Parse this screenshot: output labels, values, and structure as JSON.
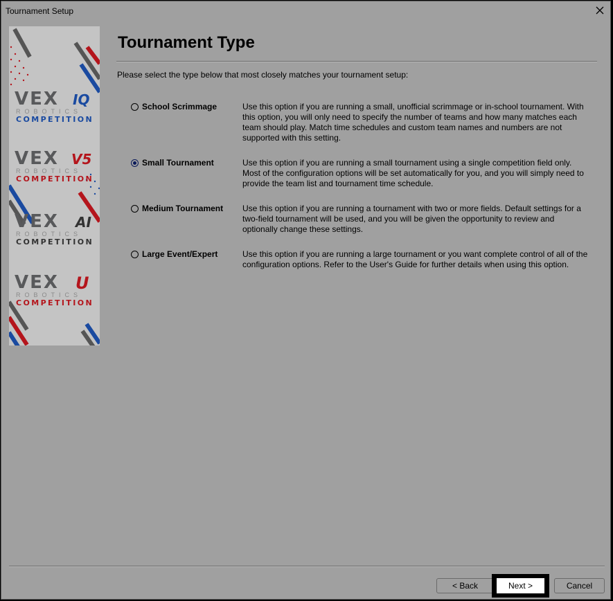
{
  "window": {
    "title": "Tournament Setup",
    "close_icon": "close-icon"
  },
  "banner": {
    "logos": [
      {
        "vex": "VEX",
        "suffix": "IQ",
        "robotics": "ROBOTICS",
        "competition": "COMPETITION",
        "accent": "#1a4aa0"
      },
      {
        "vex": "VEX",
        "suffix": "V5",
        "robotics": "ROBOTICS",
        "competition": "COMPETITION",
        "accent": "#b4151c"
      },
      {
        "vex": "VEX",
        "suffix": "AI",
        "robotics": "ROBOTICS",
        "competition": "COMPETITION",
        "accent": "#333333"
      },
      {
        "vex": "VEX",
        "suffix": "U",
        "robotics": "ROBOTICS",
        "competition": "COMPETITION",
        "accent": "#b4151c"
      }
    ]
  },
  "page": {
    "heading": "Tournament Type",
    "instruction": "Please select the type below that most closely matches your tournament setup:"
  },
  "options": [
    {
      "label": "School Scrimmage",
      "checked": false,
      "description": "Use this option if you are running a small, unofficial scrimmage or in-school tournament.  With this option, you will only need to specify the number of teams and how many matches each team should play.  Match time schedules and custom team names and numbers are not supported with this setting."
    },
    {
      "label": "Small Tournament",
      "checked": true,
      "description": "Use this option if you are running a small tournament using a single competition field only.  Most of the configuration options will be set automatically for you, and you will simply need to provide the team list and tournament time schedule."
    },
    {
      "label": "Medium Tournament",
      "checked": false,
      "description": "Use this option if you are running a tournament with two or more fields.  Default settings for a two-field tournament will be used, and you will be given the opportunity to review and optionally change these settings."
    },
    {
      "label": "Large Event/Expert",
      "checked": false,
      "description": "Use this option if you are running a large tournament or you want complete control of all of the configuration options.  Refer to the User's Guide for further details when using this option."
    }
  ],
  "buttons": {
    "back": "< Back",
    "next": "Next >",
    "cancel": "Cancel"
  },
  "colors": {
    "dialog_bg": "#a0a0a0",
    "selected_radio": "#0a1a5a",
    "vex_red": "#b4151c",
    "vex_blue": "#1a4aa0"
  }
}
